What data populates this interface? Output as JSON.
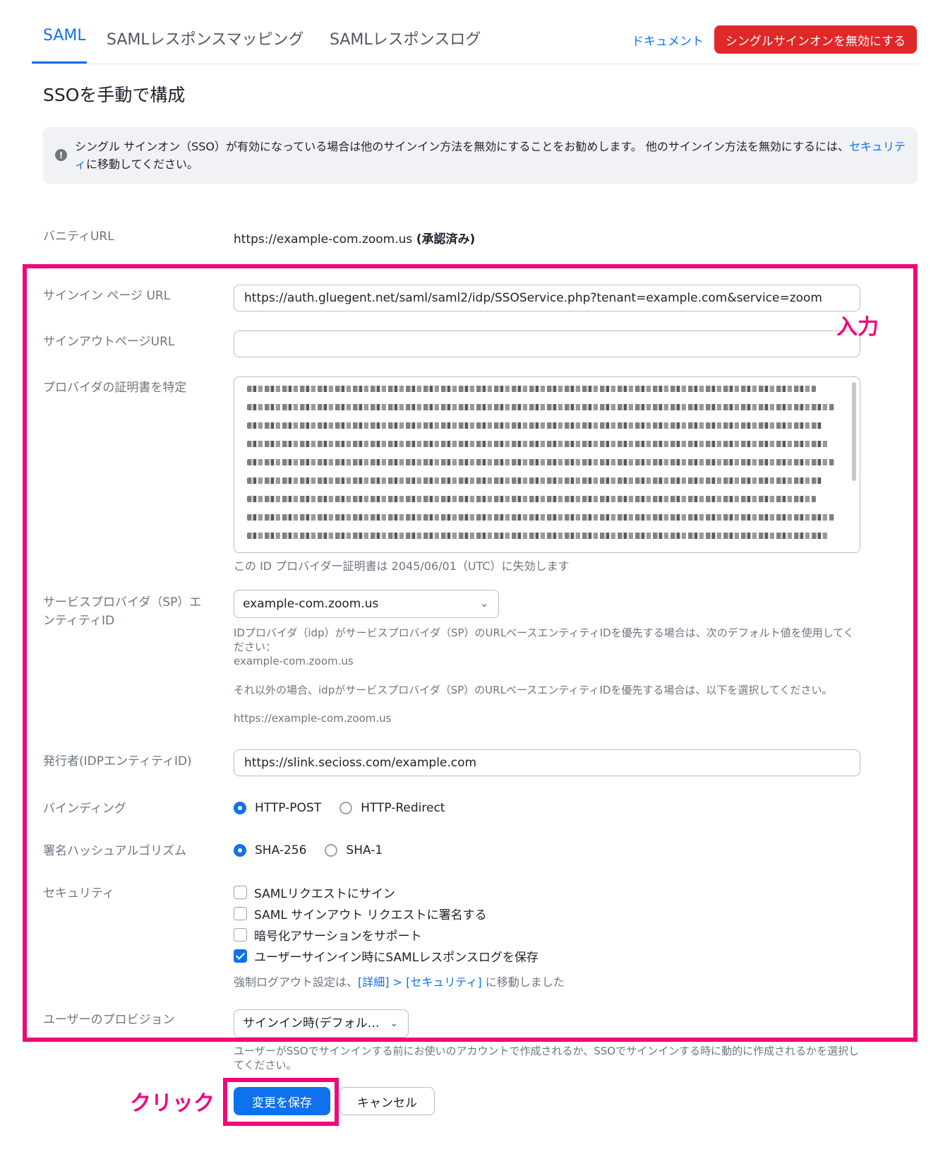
{
  "tabs": [
    {
      "label": "SAML"
    },
    {
      "label": "SAMLレスポンスマッピング"
    },
    {
      "label": "SAMLレスポンスログ"
    }
  ],
  "header": {
    "doc_link": "ドキュメント",
    "disable_sso_button": "シングルサインオンを無効にする"
  },
  "page_title": "SSOを手動で構成",
  "notice": {
    "icon": "info-icon",
    "text_before": "シングル サインオン（SSO）が有効になっている場合は他のサインイン方法を無効にすることをお勧めします。 他のサインイン方法を無効にするには、",
    "link": "セキュリティ",
    "text_after": "に移動してください。"
  },
  "vanity": {
    "label": "バニティURL",
    "value": "https://example-com.zoom.us",
    "status": "(承認済み)"
  },
  "signin_url": {
    "label": "サインイン ページ URL",
    "value": "https://auth.gluegent.net/saml/saml2/idp/SSOService.php?tenant=example.com&service=zoom"
  },
  "signout_url": {
    "label": "サインアウトページURL",
    "value": ""
  },
  "certificate": {
    "label": "プロバイダの証明書を特定",
    "hint": "この ID プロバイダー証明書は 2045/06/01（UTC）に失効します"
  },
  "sp_entity": {
    "label": "サービスプロバイダ（SP）エンティティID",
    "selected": "example-com.zoom.us",
    "help1": "IDプロバイダ（idp）がサービスプロバイダ（SP）のURLベースエンティティIDを優先する場合は、次のデフォルト値を使用してください：",
    "help1_value": "example-com.zoom.us",
    "help2": "それ以外の場合、idpがサービスプロバイダ（SP）のURLベースエンティティIDを優先する場合は、以下を選択してください。",
    "help2_value": "https://example-com.zoom.us"
  },
  "issuer": {
    "label": "発行者(IDPエンティティID)",
    "value": "https://slink.secioss.com/example.com"
  },
  "binding": {
    "label": "バインディング",
    "options": [
      "HTTP-POST",
      "HTTP-Redirect"
    ],
    "selected": "HTTP-POST"
  },
  "hash": {
    "label": "署名ハッシュアルゴリズム",
    "options": [
      "SHA-256",
      "SHA-1"
    ],
    "selected": "SHA-256"
  },
  "security": {
    "label": "セキュリティ",
    "items": [
      {
        "label": "SAMLリクエストにサイン",
        "checked": false
      },
      {
        "label": "SAML サインアウト リクエストに署名する",
        "checked": false
      },
      {
        "label": "暗号化アサーションをサポート",
        "checked": false
      },
      {
        "label": "ユーザーサインイン時にSAMLレスポンスログを保存",
        "checked": true
      }
    ],
    "note_before": "強制ログアウト設定は、",
    "note_link": "[詳細] > [セキュリティ]",
    "note_after": " に移動しました"
  },
  "provisioning": {
    "label": "ユーザーのプロビジョン",
    "selected": "サインイン時(デフォル…",
    "help": "ユーザーがSSOでサインインする前にお使いのアカウントで作成されるか、SSOでサインインする時に動的に作成されるかを選択してください。"
  },
  "actions": {
    "save": "変更を保存",
    "cancel": "キャンセル"
  },
  "annotations": {
    "input": "入力",
    "click": "クリック",
    "color": "#f0087a"
  },
  "colors": {
    "accent": "#0e72ed",
    "danger": "#e02828"
  }
}
